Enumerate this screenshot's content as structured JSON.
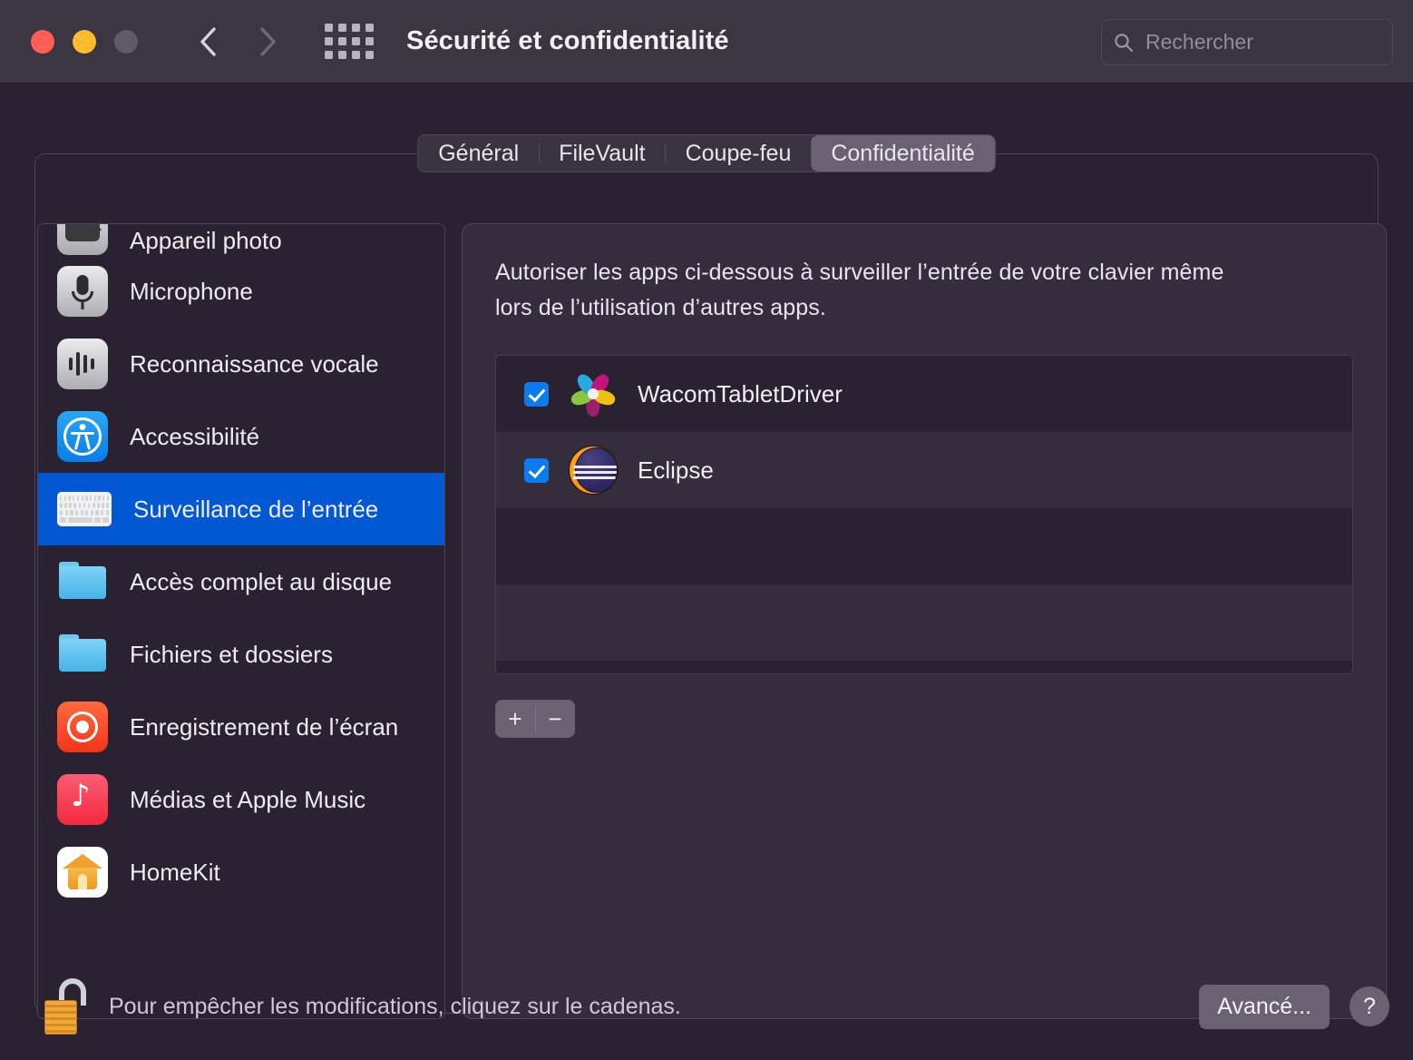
{
  "window": {
    "title": "Sécurité et confidentialité",
    "traffic_lights": [
      "close",
      "minimize",
      "zoom"
    ],
    "nav": {
      "back": "back-arrow",
      "forward": "forward-arrow"
    },
    "grid_button": "show-all-icon"
  },
  "search": {
    "placeholder": "Rechercher",
    "value": "",
    "icon": "search-icon"
  },
  "tabs": [
    {
      "label": "Général",
      "active": false
    },
    {
      "label": "FileVault",
      "active": false
    },
    {
      "label": "Coupe-feu",
      "active": false
    },
    {
      "label": "Confidentialité",
      "active": true
    }
  ],
  "sidebar": {
    "items": [
      {
        "label": "Appareil photo",
        "icon": "camera-icon",
        "selected": false,
        "clipped": true
      },
      {
        "label": "Microphone",
        "icon": "microphone-icon",
        "selected": false
      },
      {
        "label": "Reconnaissance vocale",
        "icon": "speech-recognition-icon",
        "selected": false
      },
      {
        "label": "Accessibilité",
        "icon": "accessibility-icon",
        "selected": false
      },
      {
        "label": "Surveillance de l’entrée",
        "icon": "keyboard-icon",
        "selected": true
      },
      {
        "label": "Accès complet au disque",
        "icon": "folder-icon",
        "selected": false
      },
      {
        "label": "Fichiers et dossiers",
        "icon": "folder-icon",
        "selected": false
      },
      {
        "label": "Enregistrement de l’écran",
        "icon": "screen-recording-icon",
        "selected": false
      },
      {
        "label": "Médias et Apple Music",
        "icon": "music-icon",
        "selected": false
      },
      {
        "label": "HomeKit",
        "icon": "homekit-icon",
        "selected": false
      }
    ]
  },
  "main": {
    "description": "Autoriser les apps ci-dessous à surveiller l’entrée de votre clavier même lors de l’utilisation d’autres apps.",
    "apps": [
      {
        "name": "WacomTabletDriver",
        "checked": true,
        "icon": "wacom-icon"
      },
      {
        "name": "Eclipse",
        "checked": true,
        "icon": "eclipse-icon"
      }
    ],
    "add_label": "+",
    "remove_label": "−"
  },
  "footer": {
    "lock_icon": "unlocked-padlock-icon",
    "lock_text": "Pour empêcher les modifications, cliquez sur le cadenas.",
    "advanced_label": "Avancé...",
    "help_label": "?"
  },
  "colors": {
    "window_bg": "#2a2230",
    "titlebar_bg": "#3c3542",
    "panel_bg": "#352d3c",
    "accent_blue": "#0158d2",
    "checkbox_blue": "#0b7cf0",
    "button_grey": "#6a6272",
    "text_primary": "#f0edf3",
    "text_secondary": "#cfc9d6"
  }
}
